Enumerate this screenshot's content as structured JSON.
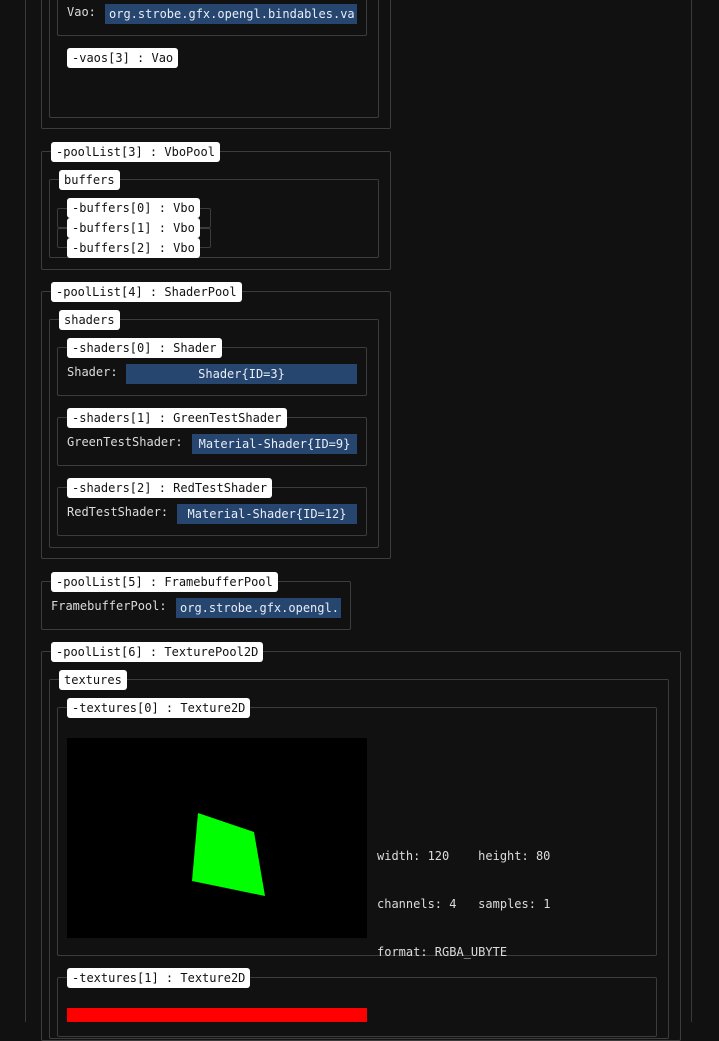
{
  "vao_section": {
    "vao_label": "Vao:",
    "vao_value": "org.strobe.gfx.opengl.bindables.va",
    "vaos3_tag": "-vaos[3] : Vao"
  },
  "pool3": {
    "title": "-poolList[3] : VboPool",
    "buffers_tag": "buffers",
    "items": [
      "-buffers[0] : Vbo",
      "-buffers[1] : Vbo",
      "-buffers[2] : Vbo"
    ]
  },
  "pool4": {
    "title": "-poolList[4] : ShaderPool",
    "shaders_tag": "shaders",
    "shaders": [
      {
        "tag": "-shaders[0] : Shader",
        "label": "Shader:",
        "value": "Shader{ID=3}"
      },
      {
        "tag": "-shaders[1] : GreenTestShader",
        "label": "GreenTestShader:",
        "value": "Material-Shader{ID=9}"
      },
      {
        "tag": "-shaders[2] : RedTestShader",
        "label": "RedTestShader:",
        "value": "Material-Shader{ID=12}"
      }
    ]
  },
  "pool5": {
    "title": "-poolList[5] : FramebufferPool",
    "label": "FramebufferPool:",
    "value": "org.strobe.gfx.opengl."
  },
  "pool6": {
    "title": "-poolList[6] : TexturePool2D",
    "textures_tag": "textures",
    "textures": [
      {
        "tag": "-textures[0] : Texture2D",
        "width": "width: 120",
        "height": "height: 80",
        "channels": "channels: 4",
        "samples": "samples: 1",
        "format": "format: RGBA_UBYTE"
      },
      {
        "tag": "-textures[1] : Texture2D"
      }
    ]
  },
  "colors": {
    "background": "#111111",
    "field": "#26456f",
    "green_shape": "#00ff00",
    "red_texture": "#ff0000"
  }
}
